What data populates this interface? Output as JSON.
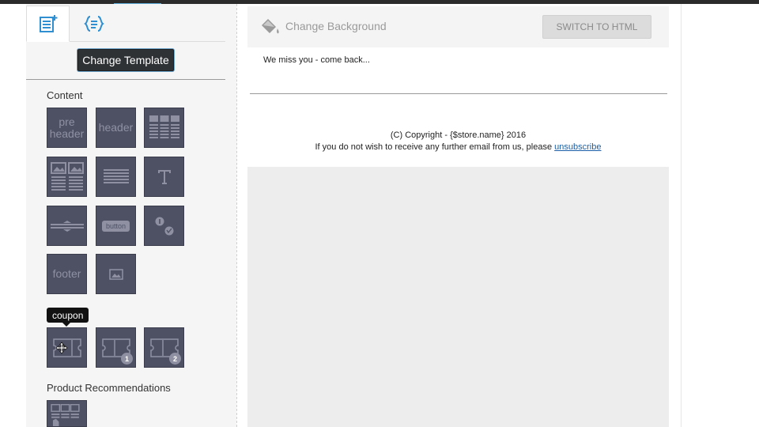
{
  "sidebar": {
    "tabs": [
      {
        "name": "blocks-tab",
        "icon": "add-block-icon",
        "active": true
      },
      {
        "name": "code-tab",
        "icon": "code-braces-icon",
        "active": false
      }
    ],
    "change_template_label": "Change Template",
    "content_title": "Content",
    "blocks": {
      "preheader": "pre header",
      "header": "header",
      "button": "button",
      "footer": "footer"
    },
    "tooltip": "coupon",
    "coupon_badges": [
      "1",
      "2"
    ],
    "product_recommendations_title": "Product Recommendations"
  },
  "editor": {
    "change_background_label": "Change Background",
    "switch_html_label": "SWITCH TO HTML",
    "email_text": "We miss you - come back...",
    "footer_copyright": "(C) Copyright - {$store.name} 2016",
    "footer_unsub_prefix": "If you do not wish to receive any further email from us, please ",
    "footer_unsub_link": "unsubscribe"
  },
  "colors": {
    "block_bg": "#4e5064",
    "block_fg": "#8f91a3",
    "accent_link": "#1a5fa8",
    "tab_icon": "#2f8fd1"
  }
}
